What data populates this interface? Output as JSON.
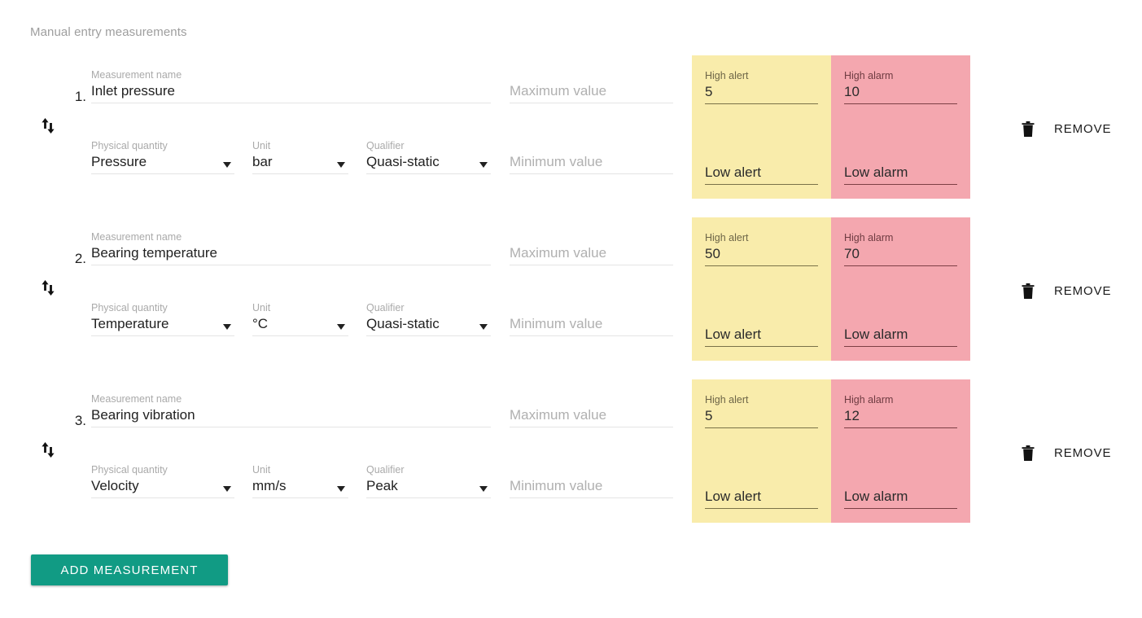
{
  "section": {
    "title": "Manual entry measurements"
  },
  "labels": {
    "measurement_name": "Measurement name",
    "physical_quantity": "Physical quantity",
    "unit": "Unit",
    "qualifier": "Qualifier",
    "maximum_value": "Maximum value",
    "minimum_value": "Minimum value",
    "high_alert": "High alert",
    "low_alert": "Low alert",
    "high_alarm": "High alarm",
    "low_alarm": "Low alarm",
    "remove": "REMOVE",
    "add_measurement": "ADD MEASUREMENT"
  },
  "colors": {
    "alert_panel": "#f9ecab",
    "alarm_panel": "#f4a7af",
    "add_button": "#119b84",
    "heading_text": "#9e9e9e",
    "field_label": "#aaaaaa",
    "value_text": "#212121"
  },
  "rows": [
    {
      "index": "1.",
      "name": "Inlet pressure",
      "physical_quantity": "Pressure",
      "unit": "bar",
      "qualifier": "Quasi-static",
      "maximum_value": "",
      "minimum_value": "",
      "high_alert": "5",
      "low_alert": "",
      "high_alarm": "10",
      "low_alarm": ""
    },
    {
      "index": "2.",
      "name": "Bearing temperature",
      "physical_quantity": "Temperature",
      "unit": "°C",
      "qualifier": "Quasi-static",
      "maximum_value": "",
      "minimum_value": "",
      "high_alert": "50",
      "low_alert": "",
      "high_alarm": "70",
      "low_alarm": ""
    },
    {
      "index": "3.",
      "name": "Bearing vibration",
      "physical_quantity": "Velocity",
      "unit": "mm/s",
      "qualifier": "Peak",
      "maximum_value": "",
      "minimum_value": "",
      "high_alert": "5",
      "low_alert": "",
      "high_alarm": "12",
      "low_alarm": ""
    }
  ],
  "icons": {
    "reorder": "reorder-up-down-icon",
    "trash": "trash-icon",
    "select_caret": "chevron-down-icon"
  }
}
